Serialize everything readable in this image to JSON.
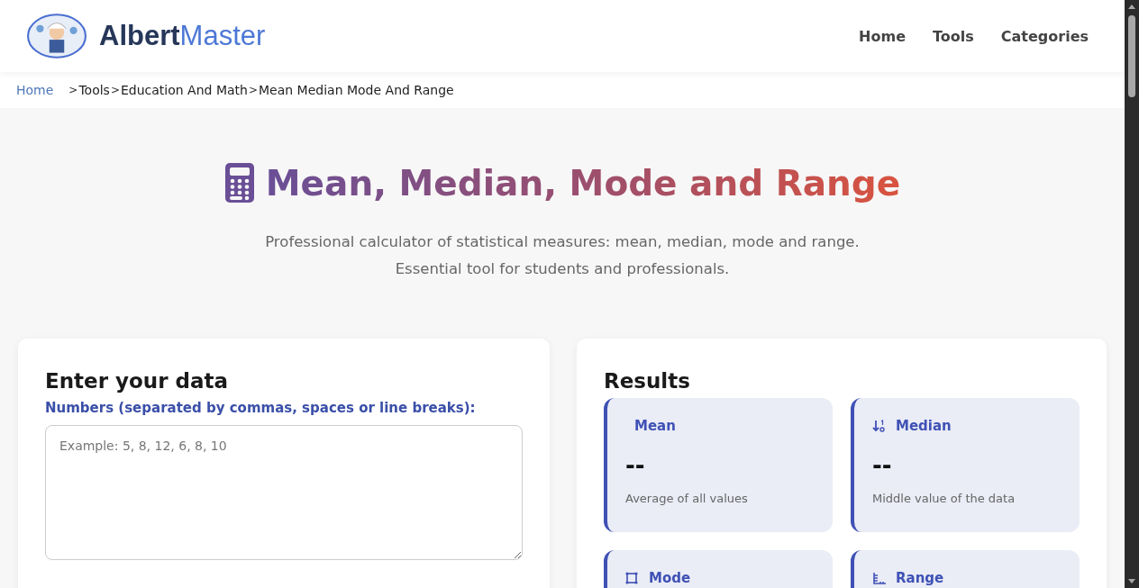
{
  "header": {
    "logo": {
      "part_1": "Albert",
      "part_2": "Master"
    },
    "nav": [
      {
        "label": "Home"
      },
      {
        "label": "Tools"
      },
      {
        "label": "Categories"
      }
    ]
  },
  "breadcrumb": [
    {
      "label": "Home",
      "kind": "link"
    },
    {
      "separator": ">",
      "label": "Tools",
      "kind": "text"
    },
    {
      "separator": ">",
      "label": "Education And Math",
      "kind": "text"
    },
    {
      "separator": ">",
      "label": "Mean Median Mode And Range",
      "kind": "text"
    }
  ],
  "hero": {
    "title": "Mean, Median, Mode and Range",
    "subtitle": [
      "Professional calculator of statistical measures: mean, median, mode and range.",
      "Essential tool for students and professionals."
    ]
  },
  "input_card": {
    "title": "Enter your data",
    "label": "Numbers (separated by commas, spaces or line breaks):",
    "placeholder": "Example: 5, 8, 12, 6, 8, 10"
  },
  "results": {
    "title": "Results",
    "cards": [
      {
        "kind": "plain",
        "label": "Mean",
        "value": "--",
        "description": "Average of all values"
      },
      {
        "kind": "median",
        "label": "Median",
        "value": "--",
        "description": "Middle value of the data"
      },
      {
        "kind": "mode",
        "label": "Mode"
      },
      {
        "kind": "range",
        "label": "Range"
      }
    ]
  }
}
